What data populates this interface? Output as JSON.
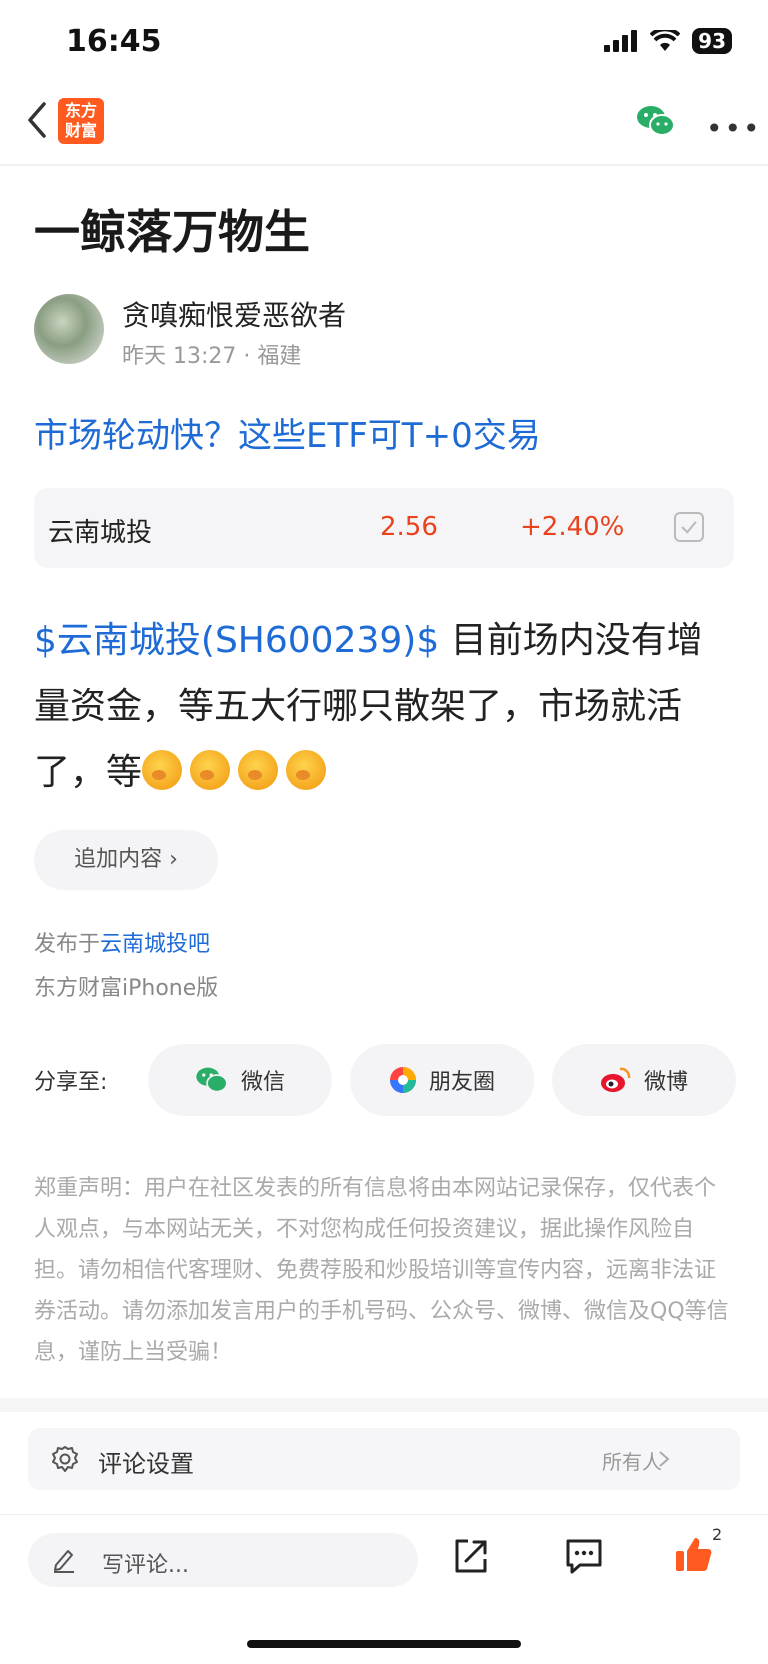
{
  "status_bar": {
    "time": "16:45",
    "battery": "93"
  },
  "header": {
    "logo_text": "东方财富"
  },
  "article": {
    "title": "一鲸落万物生",
    "author": "贪嗔痴恨爱恶欲者",
    "time": "昨天 13:27",
    "location": "福建",
    "link_title": "市场轮动快？这些ETF可T+0交易",
    "stock": {
      "name": "云南城投",
      "price": "2.56",
      "change": "+2.40%"
    },
    "mention": "$云南城投(SH600239)$",
    "body": "  目前场内没有增量资金，等五大行哪只散架了，市场就活了，等",
    "emoji_count": 4,
    "add_content": "追加内容",
    "posted_prefix": "发布于",
    "posted_board": "云南城投吧",
    "client": "东方财富iPhone版"
  },
  "share": {
    "label": "分享至:",
    "items": [
      {
        "label": "微信",
        "icon": "wechat-icon"
      },
      {
        "label": "朋友圈",
        "icon": "moments-icon"
      },
      {
        "label": "微博",
        "icon": "weibo-icon"
      }
    ]
  },
  "disclaimer": "郑重声明：用户在社区发表的所有信息将由本网站记录保存，仅代表个人观点，与本网站无关，不对您构成任何投资建议，据此操作风险自担。请勿相信代客理财、免费荐股和炒股培训等宣传内容，远离非法证券活动。请勿添加发言用户的手机号码、公众号、微博、微信及QQ等信息，谨防上当受骗！",
  "comment_settings": {
    "label": "评论设置",
    "value": "所有人"
  },
  "bottom": {
    "placeholder": "写评论...",
    "like_count": "2"
  },
  "colors": {
    "accent_blue": "#1e6bd6",
    "price_red": "#e8431d",
    "like_orange": "#ff5a1f",
    "wechat_green": "#2aae67"
  }
}
